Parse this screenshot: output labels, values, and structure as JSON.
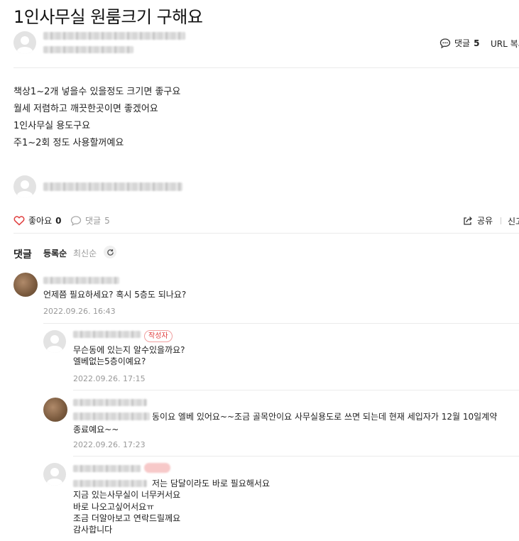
{
  "post": {
    "title": "1인사무실 원룸크기 구해요",
    "comment_label": "댓글",
    "comment_count": "5",
    "url_copy": "URL 복사",
    "body_lines": [
      "책상1~2개 넣을수 있을정도 크기면 좋구요",
      "월세 저렴하고 깨끗한곳이면 좋겠어요",
      "1인사무실 용도구요",
      "주1~2회 정도 사용할꺼예요"
    ]
  },
  "actions": {
    "like_label": "좋아요",
    "like_count": "0",
    "comment_label": "댓글",
    "comment_count": "5",
    "share_label": "공유",
    "report_label": "신고"
  },
  "comments_section": {
    "heading": "댓글",
    "sort_registered": "등록순",
    "sort_latest": "최신순",
    "refresh_icon": "refresh-icon"
  },
  "comments": [
    {
      "text_lines": [
        "언제쯤 필요하세요? 혹시 5층도 되나요?"
      ],
      "date": "2022.09.26. 16:43"
    },
    {
      "author_tag": "작성자",
      "text_lines": [
        "무슨동에 있는지 알수있을까요?",
        "엘베없는5층이예요?"
      ],
      "date": "2022.09.26. 17:15"
    },
    {
      "text_lines": [
        "동이요 엘베 있어요~~조금 골목안이요 사무실용도로 쓰면 되는데 현재 세입자가 12월 10일계약",
        "종료예요~~"
      ],
      "date": "2022.09.26. 17:23"
    },
    {
      "text_lines": [
        "저는 담달이라도 바로 필요해서요",
        "지금 있는사무실이 너무커서요",
        "바로 나오고싶어서요ㅠ",
        "조금 더알아보고 연락드릴께요",
        "감사합니다"
      ]
    }
  ],
  "colors": {
    "like_heart": "#e03e3e",
    "author_tag": "#e03e3e",
    "muted_text": "#999999"
  }
}
